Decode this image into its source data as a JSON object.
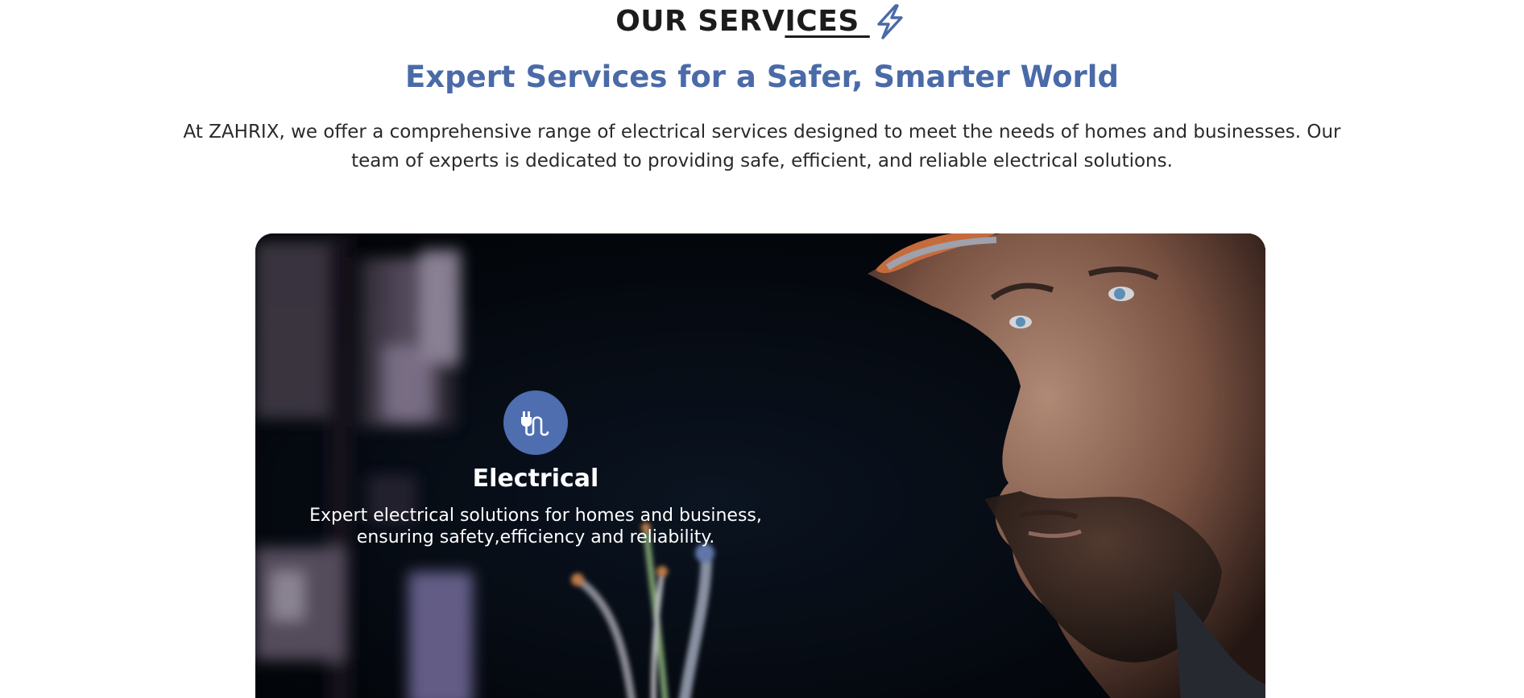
{
  "section": {
    "heading_prefix": "OUR SERV",
    "heading_underlined": "ICES ",
    "heading_icon": "lightning-bolt-icon",
    "subtitle": "Expert Services for a Safer, Smarter World",
    "intro": "At ZAHRIX, we offer a comprehensive range of electrical services designed to meet the needs of homes and businesses. Our team of experts is dedicated to providing safe, efficient, and reliable electrical solutions."
  },
  "service_card": {
    "icon": "electrical-plug-icon",
    "title": "Electrical",
    "description": "Expert electrical solutions for homes and business, ensuring safety,efficiency and reliability."
  },
  "colors": {
    "accent": "#4a6aa8",
    "icon_circle": "#4e6eb0",
    "heading": "#1c1c1c",
    "text": "#2a2a2a",
    "card_background": "#060b12"
  }
}
